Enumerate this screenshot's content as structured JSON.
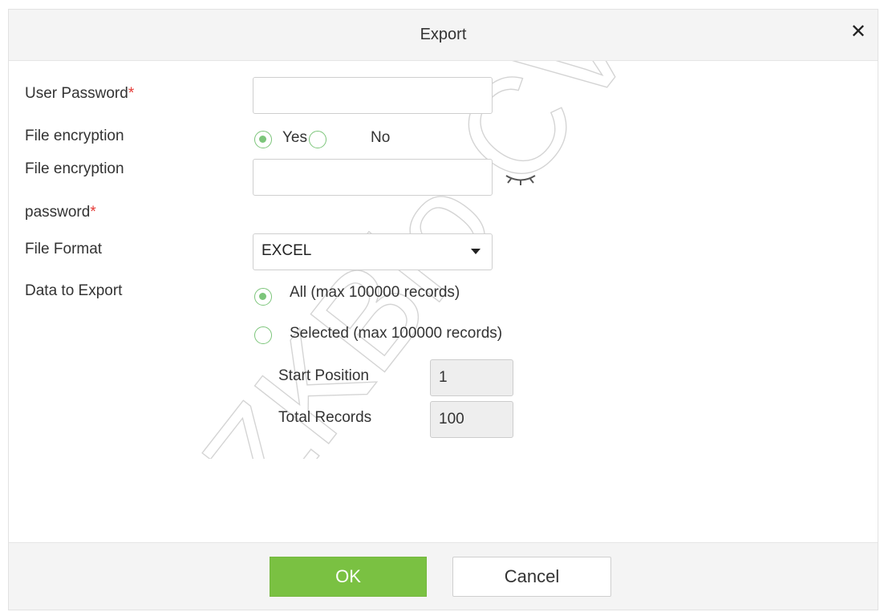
{
  "dialog": {
    "title": "Export",
    "close_icon": "close-icon"
  },
  "form": {
    "user_password": {
      "label": "User Password",
      "required_mark": "*",
      "value": ""
    },
    "file_encryption": {
      "label": "File encryption",
      "options": [
        {
          "label": "Yes",
          "selected": true
        },
        {
          "label": "No",
          "selected": false
        }
      ]
    },
    "encryption_password": {
      "label_line1": "File encryption",
      "label_line2": "password",
      "required_mark": "*",
      "value": "",
      "toggle_icon": "eye-closed-icon"
    },
    "file_format": {
      "label": "File Format",
      "value": "EXCEL"
    },
    "data_to_export": {
      "label": "Data to Export",
      "options": [
        {
          "label": "All (max 100000 records)",
          "selected": true
        },
        {
          "label": "Selected (max 100000 records)",
          "selected": false
        }
      ],
      "start_position": {
        "label": "Start Position",
        "value": "1"
      },
      "total_records": {
        "label": "Total Records",
        "value": "100"
      }
    }
  },
  "footer": {
    "ok_label": "OK",
    "cancel_label": "Cancel"
  },
  "watermark": "ZKBio CVSecurity",
  "colors": {
    "accent_green": "#7ac142",
    "radio_green": "#7cc57a",
    "required_red": "#e53935",
    "header_bg": "#f4f4f4"
  }
}
